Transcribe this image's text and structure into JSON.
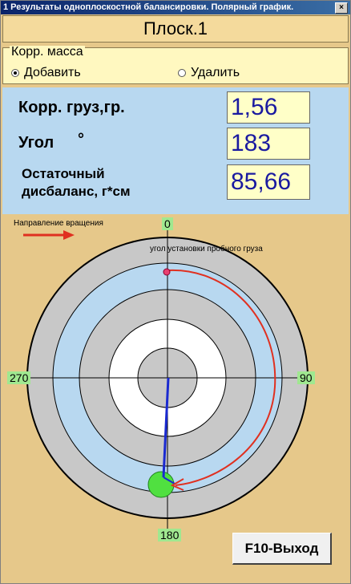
{
  "window": {
    "title": "1 Результаты одноплоскостной балансировки. Полярный график.",
    "close_glyph": "×"
  },
  "plane_title": "Плоск.1",
  "corr_mass": {
    "legend": "Корр. масса",
    "add_label": "Добавить",
    "remove_label": "Удалить",
    "selected": "add"
  },
  "results": {
    "weight_label": "Корр. груз,гр.",
    "weight_value": "1,56",
    "angle_label": "Угол",
    "angle_unit": "°",
    "angle_value": "183",
    "residual_label_1": "Остаточный",
    "residual_label_2": "дисбаланс, г*см",
    "residual_value": "85,66"
  },
  "polar": {
    "rotation_label": "Направление вращения",
    "trial_label": "угол установки пробного  груза",
    "tick_0": "0",
    "tick_90": "90",
    "tick_180": "180",
    "tick_270": "270",
    "colors": {
      "ring_gray": "#c8c8c8",
      "ring_blue": "#b8d8f0",
      "ring_white": "#ffffff",
      "arrow_red": "#e03020",
      "vector_blue": "#1a2ad0",
      "weight_green": "#50e040"
    }
  },
  "exit_button": "F10-Выход"
}
